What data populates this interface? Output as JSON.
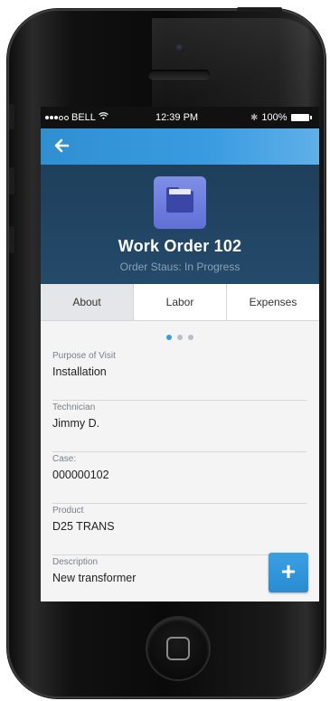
{
  "status_bar": {
    "carrier": "BELL",
    "time": "12:39 PM",
    "battery": "100%"
  },
  "nav": {
    "back_icon": "arrow-left-icon"
  },
  "header": {
    "title": "Work Order 102",
    "subtitle": "Order Staus: In Progress",
    "icon": "folder-icon"
  },
  "tabs": [
    {
      "label": "About",
      "active": true
    },
    {
      "label": "Labor",
      "active": false
    },
    {
      "label": "Expenses",
      "active": false
    }
  ],
  "pager": {
    "count": 3,
    "active_index": 0
  },
  "fields": [
    {
      "label": "Purpose of Visit",
      "value": "Installation"
    },
    {
      "label": "Technician",
      "value": "Jimmy D."
    },
    {
      "label": "Case:",
      "value": "000000102"
    },
    {
      "label": "Product",
      "value": "D25 TRANS"
    },
    {
      "label": "Description",
      "value": "New transformer"
    }
  ],
  "fab": {
    "label": "+",
    "icon": "plus-icon"
  },
  "colors": {
    "accent": "#3a9be0",
    "header_bg": "#244a6a",
    "folder_tile": "#6f7fe0"
  }
}
